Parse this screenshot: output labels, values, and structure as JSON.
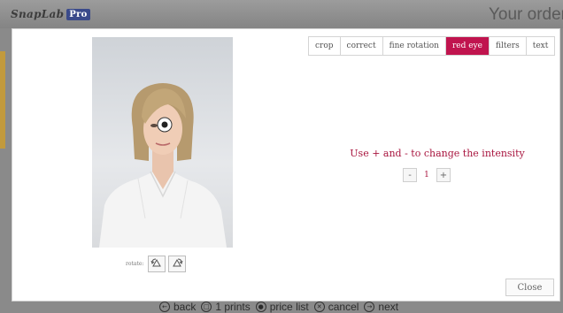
{
  "app": {
    "brand": "SnapLab",
    "brand_badge": "Pro",
    "title": "Your order"
  },
  "editor": {
    "tabs": [
      {
        "label": "crop"
      },
      {
        "label": "correct"
      },
      {
        "label": "fine rotation"
      },
      {
        "label": "red eye",
        "active": true
      },
      {
        "label": "filters"
      },
      {
        "label": "text"
      }
    ],
    "instruction": "Use + and - to change the intensity",
    "intensity": {
      "minus_label": "-",
      "value": "1",
      "plus_label": "+"
    },
    "rotate_label": "rotate:",
    "close_label": "Close",
    "colors": {
      "accent": "#c0144e",
      "instruction": "#a8143e"
    }
  },
  "bottom_nav": {
    "back": "back",
    "prints": "1 prints",
    "price_list": "price list",
    "cancel": "cancel",
    "next": "next"
  },
  "icons": {
    "rotate_left": "rotate-left-icon",
    "rotate_right": "rotate-right-icon",
    "back": "back-arrow-icon",
    "prints": "prints-icon",
    "price_list": "price-list-icon",
    "cancel": "cancel-x-icon",
    "next": "next-arrow-icon",
    "red_eye_cursor": "red-eye-cursor-icon"
  }
}
